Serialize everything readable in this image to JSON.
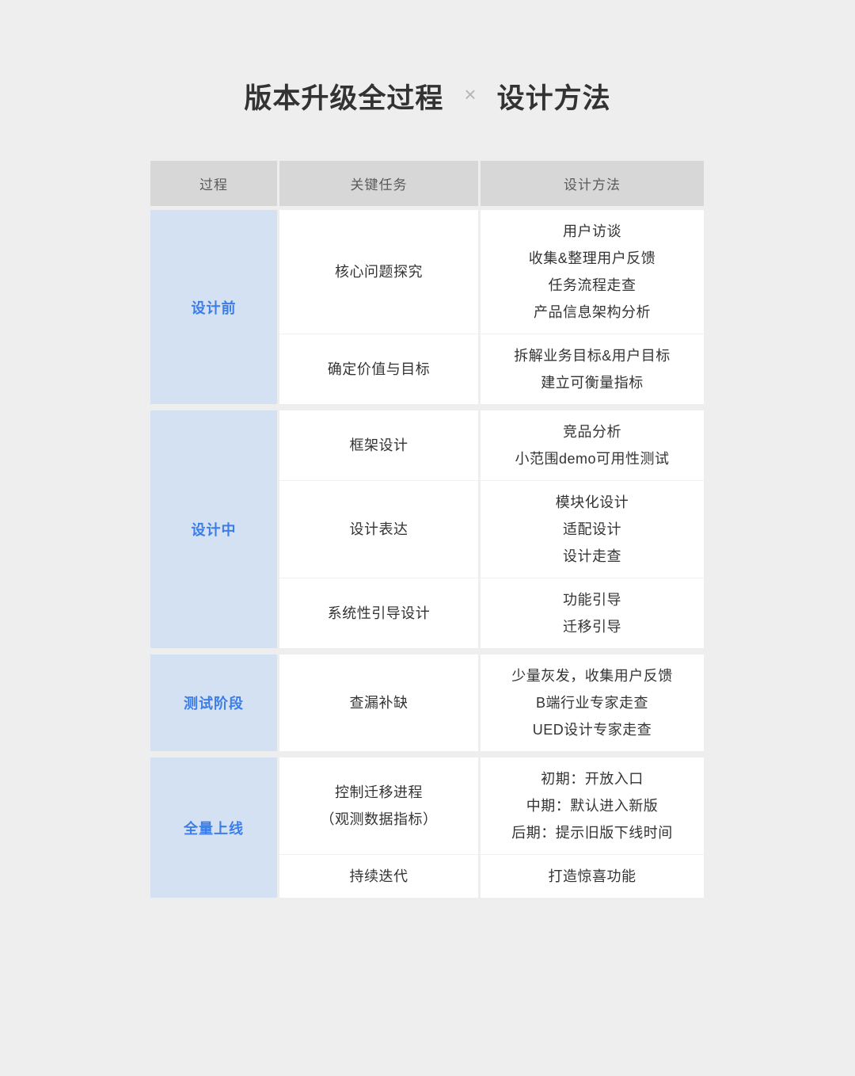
{
  "page": {
    "background_color": "#eeeeee"
  },
  "title": {
    "left": "版本升级全过程",
    "separator": "×",
    "right": "设计方法"
  },
  "colors": {
    "header_bg": "#d7d7d7",
    "stage_bg": "#d3e1f2",
    "stage_text": "#3d7de8",
    "cell_bg": "#ffffff",
    "body_text": "#333333",
    "header_text": "#5a5a5a"
  },
  "table": {
    "columns": [
      "过程",
      "关键任务",
      "设计方法"
    ],
    "sections": [
      {
        "stage": "设计前",
        "rows": [
          {
            "task": [
              "核心问题探究"
            ],
            "methods": [
              "用户访谈",
              "收集&整理用户反馈",
              "任务流程走查",
              "产品信息架构分析"
            ]
          },
          {
            "task": [
              "确定价值与目标"
            ],
            "methods": [
              "拆解业务目标&用户目标",
              "建立可衡量指标"
            ]
          }
        ]
      },
      {
        "stage": "设计中",
        "rows": [
          {
            "task": [
              "框架设计"
            ],
            "methods": [
              "竞品分析",
              "小范围demo可用性测试"
            ]
          },
          {
            "task": [
              "设计表达"
            ],
            "methods": [
              "模块化设计",
              "适配设计",
              "设计走查"
            ]
          },
          {
            "task": [
              "系统性引导设计"
            ],
            "methods": [
              "功能引导",
              "迁移引导"
            ]
          }
        ]
      },
      {
        "stage": "测试阶段",
        "rows": [
          {
            "task": [
              "查漏补缺"
            ],
            "methods": [
              "少量灰发，收集用户反馈",
              "B端行业专家走查",
              "UED设计专家走查"
            ]
          }
        ]
      },
      {
        "stage": "全量上线",
        "rows": [
          {
            "task": [
              "控制迁移进程",
              "（观测数据指标）"
            ],
            "methods": [
              "初期：开放入口",
              "中期：默认进入新版",
              "后期：提示旧版下线时间"
            ]
          },
          {
            "task": [
              "持续迭代"
            ],
            "methods": [
              "打造惊喜功能"
            ]
          }
        ]
      }
    ]
  }
}
